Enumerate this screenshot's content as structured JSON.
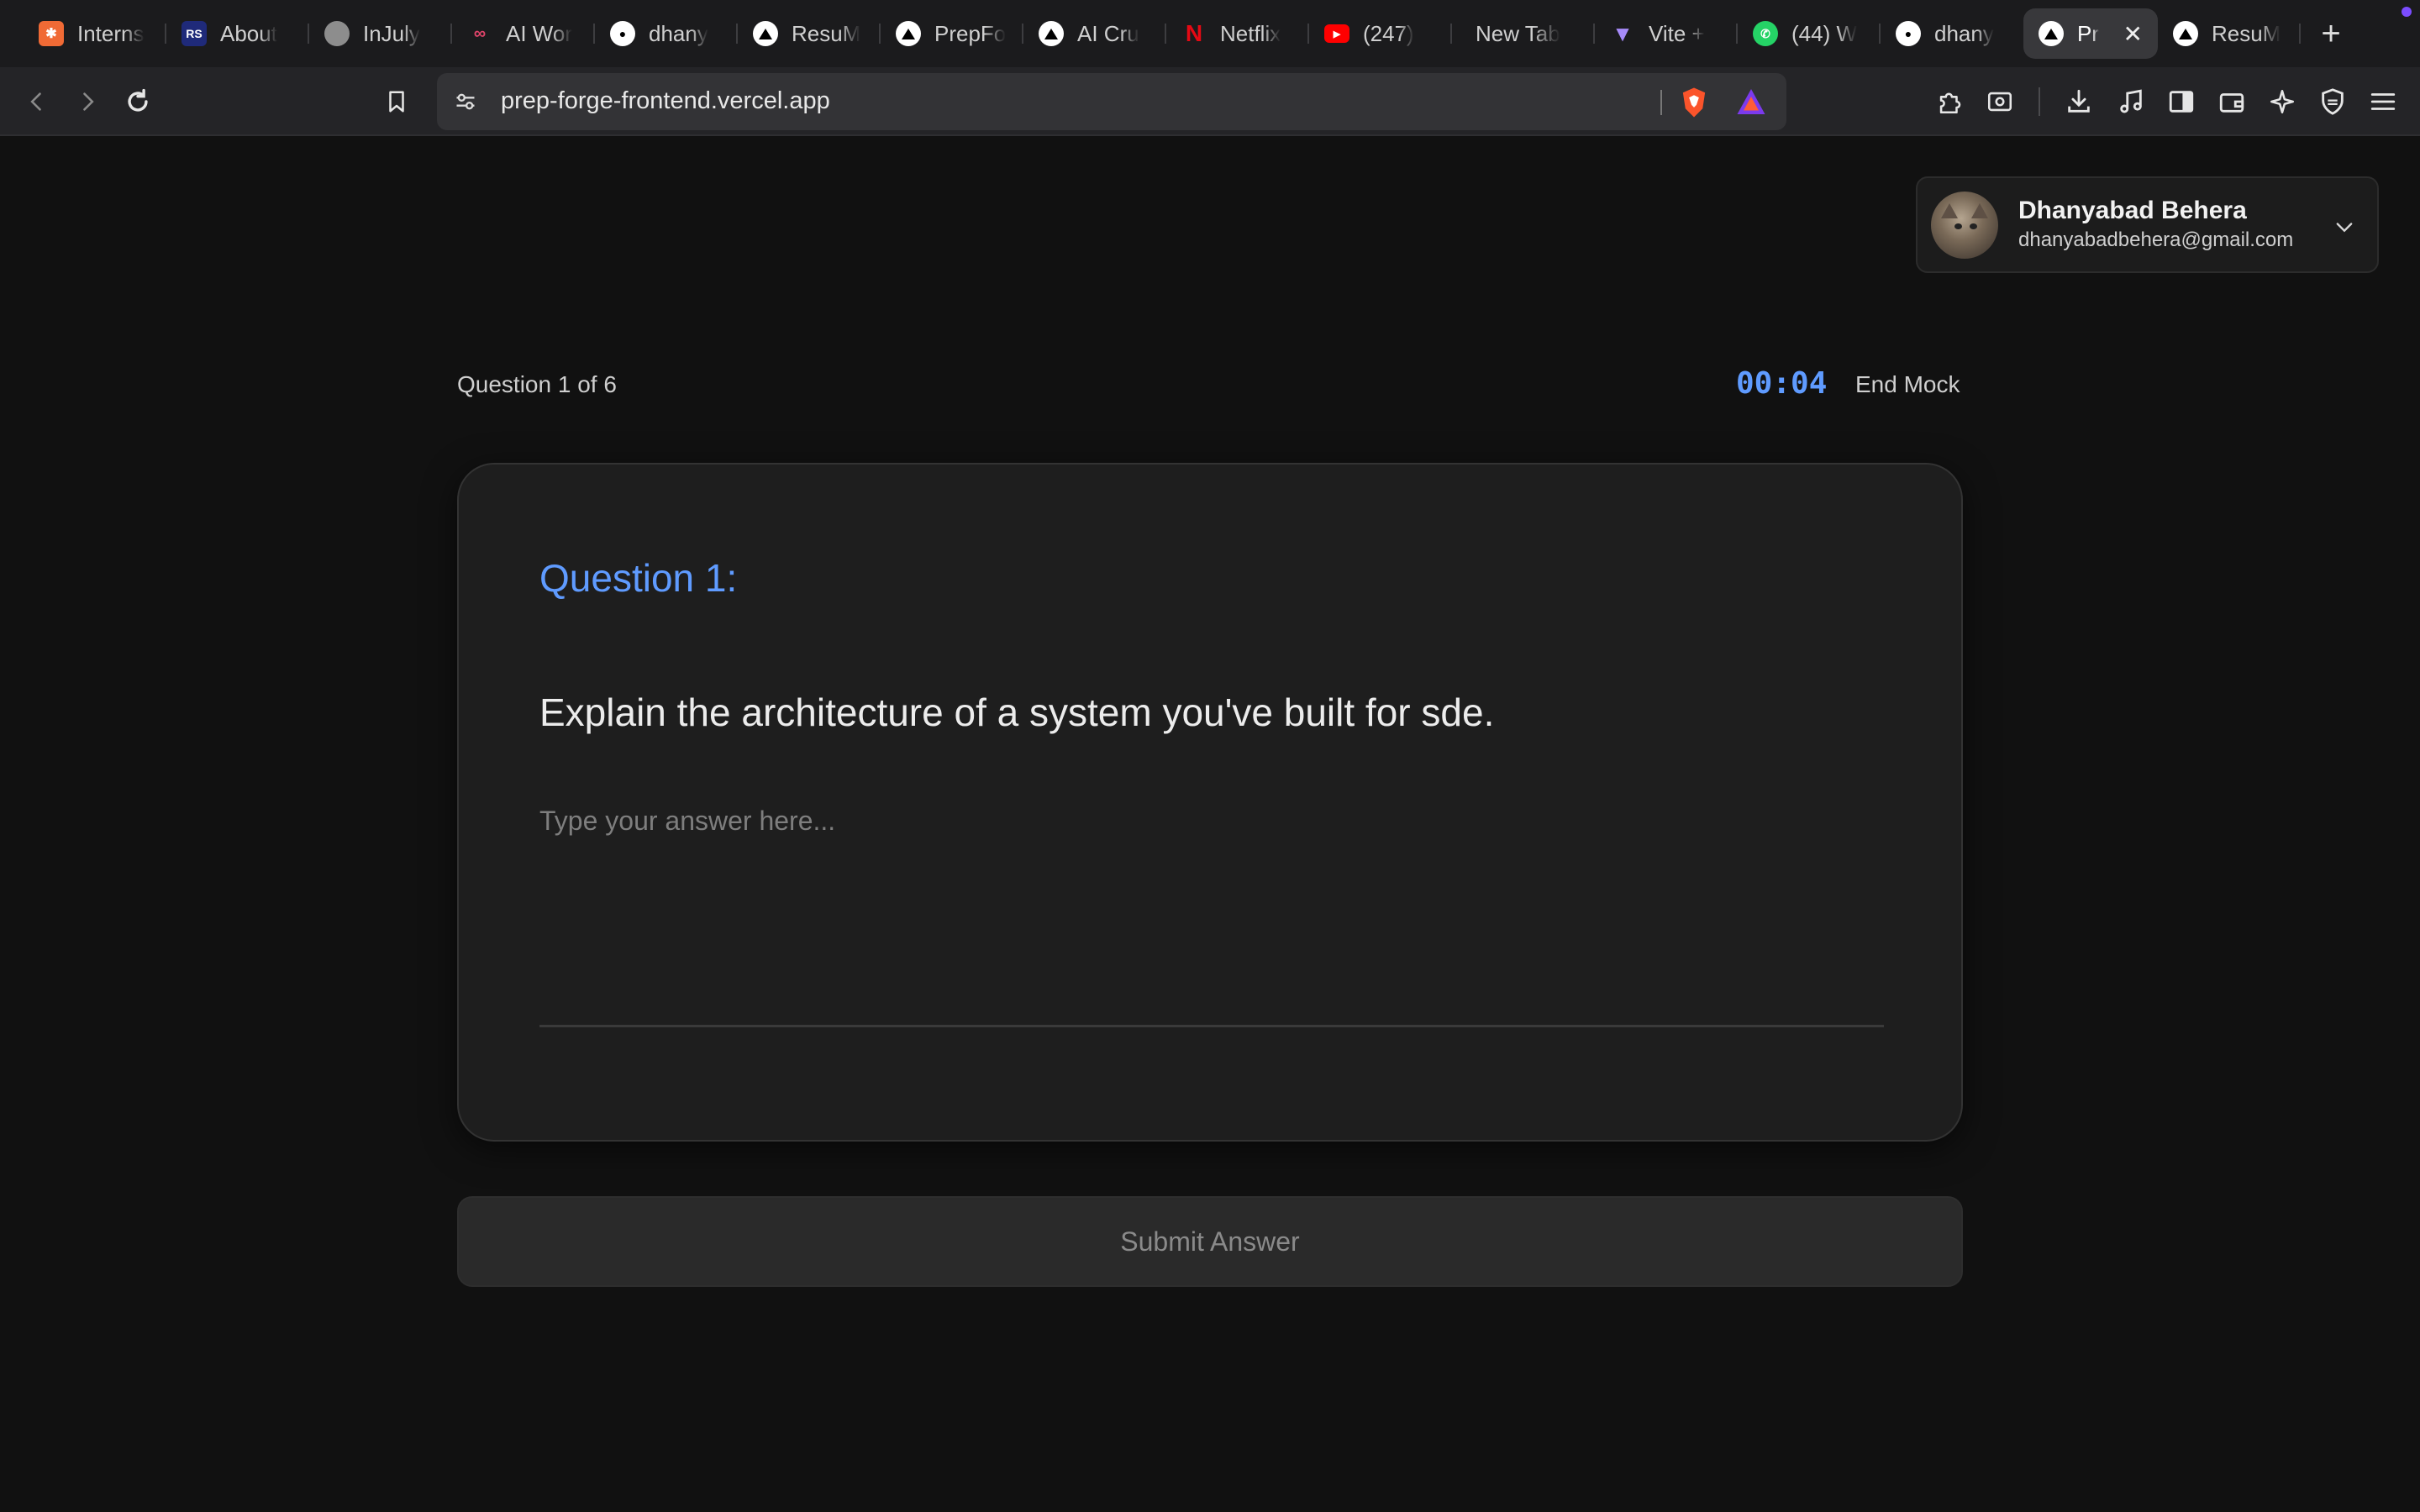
{
  "browser": {
    "tabs": [
      {
        "label": "Interns",
        "icon": "orange-star-icon",
        "color": "#f06a35"
      },
      {
        "label": "About",
        "icon": "rs-logo-icon",
        "color": "#1f2a7a"
      },
      {
        "label": "InJuly",
        "icon": "globe-icon",
        "color": "#9a9a9a"
      },
      {
        "label": "AI Wor",
        "icon": "workflow-icon",
        "color": "#e0446a"
      },
      {
        "label": "dhany",
        "icon": "github-icon",
        "color": "#ffffff"
      },
      {
        "label": "ResuM",
        "icon": "vercel-triangle-icon",
        "color": "#ffffff"
      },
      {
        "label": "PrepFo",
        "icon": "vercel-triangle-icon",
        "color": "#ffffff"
      },
      {
        "label": "AI Cru",
        "icon": "vercel-triangle-icon",
        "color": "#ffffff"
      },
      {
        "label": "Netflix",
        "icon": "netflix-icon",
        "color": "#e50914"
      },
      {
        "label": "(247)",
        "icon": "youtube-icon",
        "color": "#ff0000"
      },
      {
        "label": "New Tab",
        "icon": "",
        "color": ""
      },
      {
        "label": "Vite +",
        "icon": "vite-icon",
        "color": "#a78bfa"
      },
      {
        "label": "(44) W",
        "icon": "whatsapp-icon",
        "color": "#25d366"
      },
      {
        "label": "dhany",
        "icon": "github-icon",
        "color": "#ffffff"
      },
      {
        "label": "Pr",
        "icon": "vercel-triangle-icon",
        "color": "#ffffff",
        "active": true
      },
      {
        "label": "ResuM",
        "icon": "vercel-triangle-icon",
        "color": "#ffffff"
      }
    ],
    "url": "prep-forge-frontend.vercel.app"
  },
  "user": {
    "name": "Dhanyabad Behera",
    "email": "dhanyabadbehera@gmail.com"
  },
  "mock": {
    "counter": "Question 1 of 6",
    "timer": "00:04",
    "end_label": "End Mock",
    "question_title": "Question 1:",
    "question_text": "Explain the architecture of a system you've built for sde.",
    "answer_placeholder": "Type your answer here...",
    "answer_value": "",
    "submit_label": "Submit Answer"
  },
  "colors": {
    "accent": "#5f9bff",
    "background": "#111111",
    "card": "#1e1e1e"
  }
}
